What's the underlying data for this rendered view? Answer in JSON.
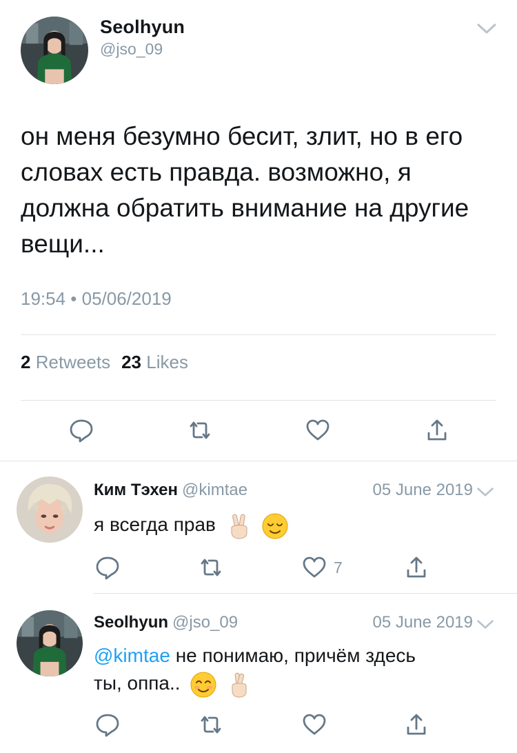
{
  "main_tweet": {
    "name": "Seolhyun",
    "handle": "@jso_09",
    "text": "он меня безумно бесит, злит, но в его словах есть правда. возможно, я должна обратить внимание на другие вещи...",
    "timestamp": "19:54 • 05/06/2019",
    "retweets_count": "2",
    "retweets_label": "Retweets",
    "likes_count": "23",
    "likes_label": "Likes",
    "icons": [
      "reply-icon",
      "retweet-icon",
      "like-icon",
      "share-icon"
    ]
  },
  "replies": [
    {
      "name": "Ким Тэхен",
      "handle": "@kimtae",
      "date": "05 June 2019",
      "text": "я всегда прав",
      "emojis": [
        "victory-hand-emoji",
        "relieved-face-emoji"
      ],
      "like_count": "7"
    },
    {
      "name": "Seolhyun",
      "handle": "@jso_09",
      "date": "05 June 2019",
      "mention": "@kimtae",
      "text_line1": "не понимаю, причём здесь",
      "text_line2": "ты, оппа..",
      "emojis": [
        "smiling-face-emoji",
        "crossed-fingers-emoji"
      ]
    }
  ],
  "colors": {
    "text": "#14171a",
    "secondary": "#8899a6",
    "link": "#1da1f2",
    "divider": "#dfe3e7",
    "icon": "#657786"
  }
}
